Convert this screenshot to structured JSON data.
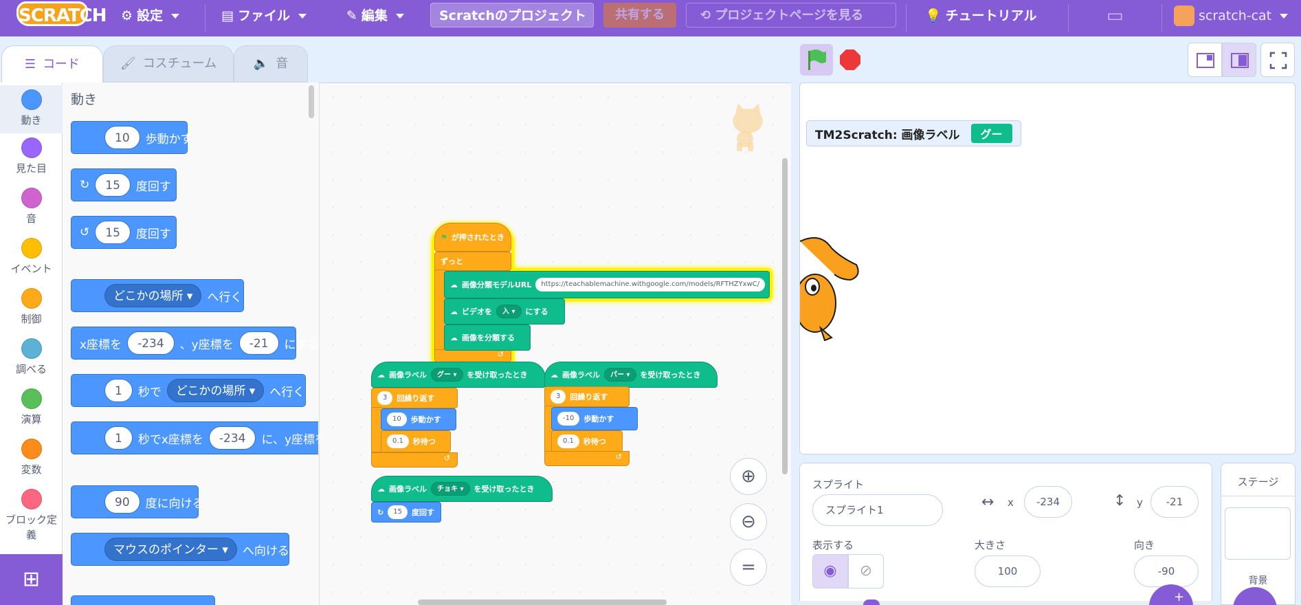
{
  "menubar": {
    "logo": "SCRATCH",
    "settings": "設定",
    "file": "ファイル",
    "edit": "編集",
    "project_title": "Scratchのプロジェクト",
    "share": "共有する",
    "project_page": "プロジェクトページを見る",
    "tutorials": "チュートリアル",
    "username": "scratch-cat"
  },
  "tabs": [
    {
      "label": "コード"
    },
    {
      "label": "コスチューム"
    },
    {
      "label": "音"
    }
  ],
  "categories": [
    {
      "label": "動き",
      "color": "#4c97ff"
    },
    {
      "label": "見た目",
      "color": "#9966ff"
    },
    {
      "label": "音",
      "color": "#cf63cf"
    },
    {
      "label": "イベント",
      "color": "#ffbf00"
    },
    {
      "label": "制御",
      "color": "#ffab19"
    },
    {
      "label": "調べる",
      "color": "#5cb1d6"
    },
    {
      "label": "演算",
      "color": "#59c059"
    },
    {
      "label": "変数",
      "color": "#ff8c1a"
    },
    {
      "label": "ブロック定義",
      "color": "#ff6680"
    }
  ],
  "palette": {
    "title": "動き",
    "b1": {
      "val": "10",
      "text": "歩動かす"
    },
    "b2": {
      "val": "15",
      "text": "度回す"
    },
    "b3": {
      "val": "15",
      "text": "度回す"
    },
    "b4": {
      "drop": "どこかの場所",
      "text": "へ行く"
    },
    "b5": {
      "pre": "x座標を",
      "x": "-234",
      "mid": "、y座標を",
      "y": "-21",
      "text": "にする"
    },
    "b6": {
      "val": "1",
      "mid": "秒で",
      "drop": "どこかの場所",
      "text": "へ行く"
    },
    "b7": {
      "val": "1",
      "mid": "秒でx座標を",
      "x": "-234",
      "text": "に、y座標を"
    },
    "b8": {
      "val": "90",
      "text": "度に向ける"
    },
    "b9": {
      "drop": "マウスのポインター",
      "text": "へ向ける"
    }
  },
  "script": {
    "flag_hat": "が押されたとき",
    "forever": "ずっと",
    "model_url_label": "画像分類モデルURL",
    "model_url": "https://teachablemachine.withgoogle.com/models/RFTHZYxwC/",
    "video_pre": "ビデオを",
    "video_val": "入",
    "video_post": "にする",
    "classify": "画像を分類する",
    "recv1": {
      "pre": "画像ラベル",
      "label": "グー",
      "post": "を受け取ったとき",
      "repeat": "3",
      "repeat_text": "回繰り返す",
      "steps": "10",
      "steps_text": "歩動かす",
      "wait": "0.1",
      "wait_text": "秒待つ"
    },
    "recv2": {
      "pre": "画像ラベル",
      "label": "パー",
      "post": "を受け取ったとき",
      "repeat": "3",
      "repeat_text": "回繰り返す",
      "steps": "-10",
      "steps_text": "歩動かす",
      "wait": "0.1",
      "wait_text": "秒待つ"
    },
    "recv3": {
      "pre": "画像ラベル",
      "label": "チョキ",
      "post": "を受け取ったとき",
      "turn": "15",
      "turn_text": "度回す"
    }
  },
  "stage": {
    "monitor_label": "TM2Scratch: 画像ラベル",
    "monitor_value": "グー"
  },
  "sprite_info": {
    "sprite_label": "スプライト",
    "sprite_name": "スプライト1",
    "x_label": "x",
    "x": "-234",
    "y_label": "y",
    "y": "-21",
    "show_label": "表示する",
    "size_label": "大きさ",
    "size": "100",
    "direction_label": "向き",
    "direction": "-90"
  },
  "stage_pane": {
    "title": "ステージ",
    "backdrop_label": "背景"
  }
}
